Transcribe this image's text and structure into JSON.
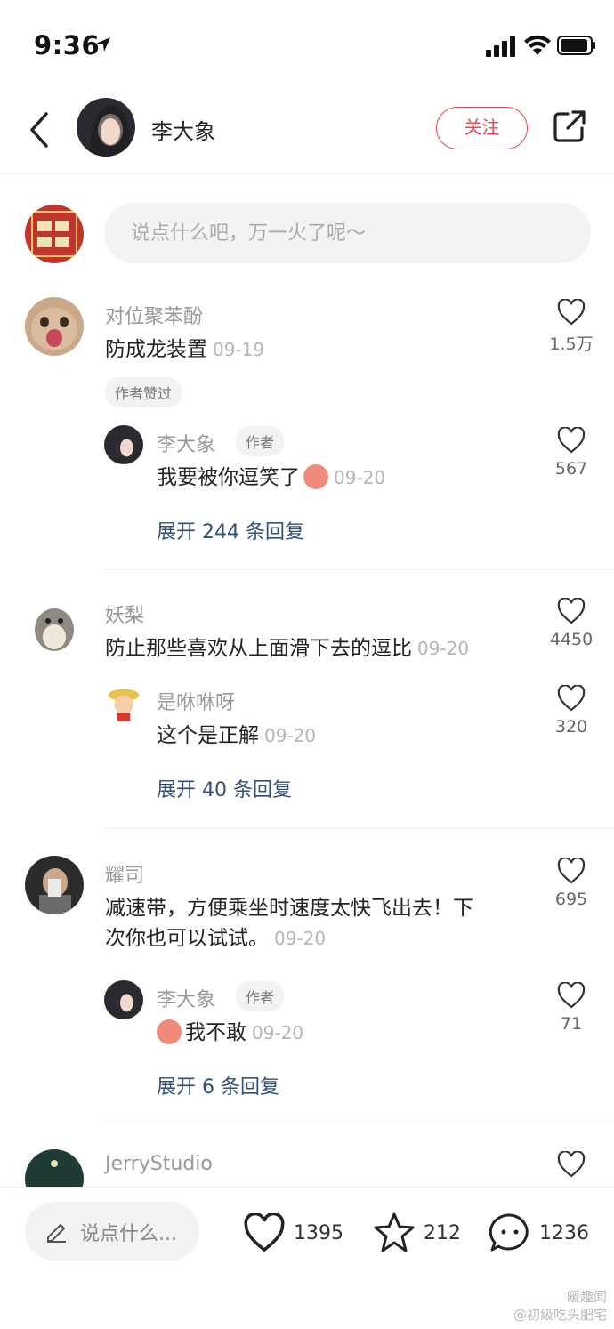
{
  "status_bar": {
    "time": "9:36"
  },
  "header": {
    "author_name": "李大象",
    "follow_label": "关注"
  },
  "composer": {
    "placeholder": "说点什么吧，万一火了呢～"
  },
  "comments": [
    {
      "username": "对位聚苯酚",
      "text": "防成龙装置",
      "date": "09-19",
      "likes": "1.5万",
      "badge": "作者赞过",
      "reply": {
        "username": "李大象",
        "author_badge": "作者",
        "text": "我要被你逗笑了",
        "date": "09-20",
        "likes": "567"
      },
      "expand_label": "展开 244 条回复"
    },
    {
      "username": "妖梨",
      "text": "防止那些喜欢从上面滑下去的逗比",
      "date": "09-20",
      "likes": "4450",
      "reply": {
        "username": "是咻咻呀",
        "text": "这个是正解",
        "date": "09-20",
        "likes": "320"
      },
      "expand_label": "展开 40 条回复"
    },
    {
      "username": "耀司",
      "text_line1": "减速带，方便乘坐时速度太快飞出去！下",
      "text_line2": "次你也可以试试。",
      "date": "09-20",
      "likes": "695",
      "reply": {
        "username": "李大象",
        "author_badge": "作者",
        "text": "我不敢",
        "date": "09-20",
        "likes": "71"
      },
      "expand_label": "展开 6 条回复"
    },
    {
      "username": "JerryStudio"
    }
  ],
  "bottom_bar": {
    "input_placeholder": "说点什么...",
    "like_count": "1395",
    "star_count": "212",
    "comment_count": "1236"
  },
  "watermark": {
    "line1": "暖趣闻",
    "line2": "@初级吃头肥宅"
  },
  "colors": {
    "accent": "#e8474f",
    "link": "#33507a",
    "meta": "#999999"
  }
}
